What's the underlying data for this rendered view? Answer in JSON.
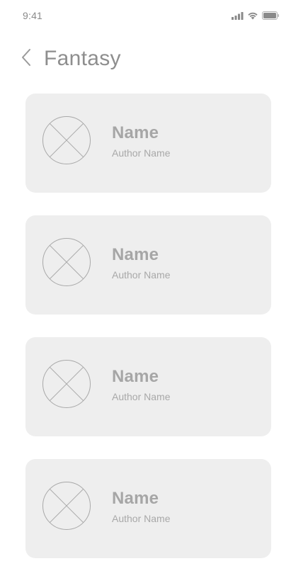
{
  "status_bar": {
    "time": "9:41",
    "icons": [
      "cellular-signal-icon",
      "wifi-icon",
      "battery-icon"
    ]
  },
  "header": {
    "back_icon": "chevron-left-icon",
    "title": "Fantasy"
  },
  "books": [
    {
      "name": "Name",
      "author": "Author Name",
      "cover_icon": "image-placeholder-icon"
    },
    {
      "name": "Name",
      "author": "Author Name",
      "cover_icon": "image-placeholder-icon"
    },
    {
      "name": "Name",
      "author": "Author Name",
      "cover_icon": "image-placeholder-icon"
    },
    {
      "name": "Name",
      "author": "Author Name",
      "cover_icon": "image-placeholder-icon"
    }
  ],
  "colors": {
    "card_background": "#eeeeee",
    "text_primary": "#a6a6a6",
    "text_secondary": "#a8a8a8",
    "title": "#8e8e8e"
  }
}
